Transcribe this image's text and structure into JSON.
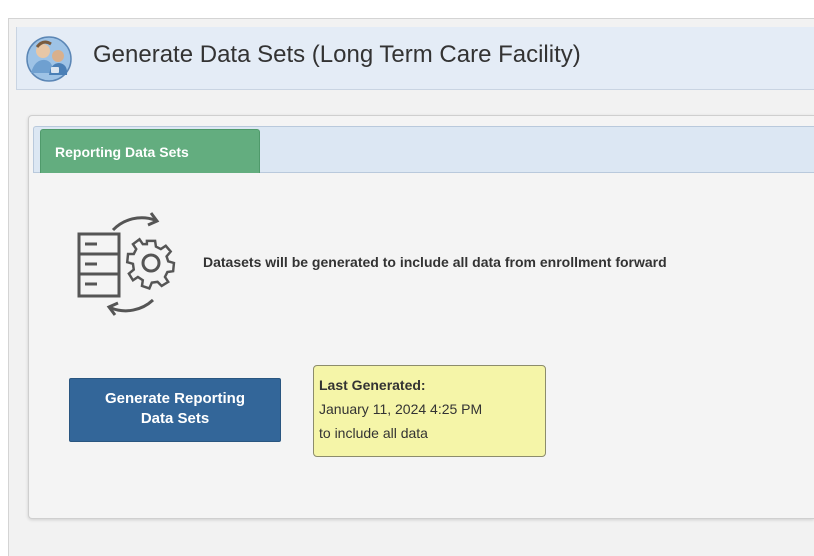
{
  "header": {
    "title": "Generate Data Sets (Long Term Care Facility)",
    "logo_icon": "nhsn-caregiver-logo-icon"
  },
  "tabs": [
    {
      "label": "Reporting Data Sets",
      "active": true
    }
  ],
  "main": {
    "icon": "database-gear-refresh-icon",
    "info_text": "Datasets will be generated to include all data from enrollment forward",
    "generate_button": {
      "line1": "Generate Reporting",
      "line2": "Data Sets"
    },
    "last_generated": {
      "label": "Last Generated:",
      "timestamp": "January 11, 2024 4:25 PM",
      "note": "to include all data"
    }
  },
  "colors": {
    "title_bar": "#e4ecf6",
    "tab_active": "#63ad7f",
    "button": "#336699",
    "tooltip_bg": "#f5f5a8"
  }
}
